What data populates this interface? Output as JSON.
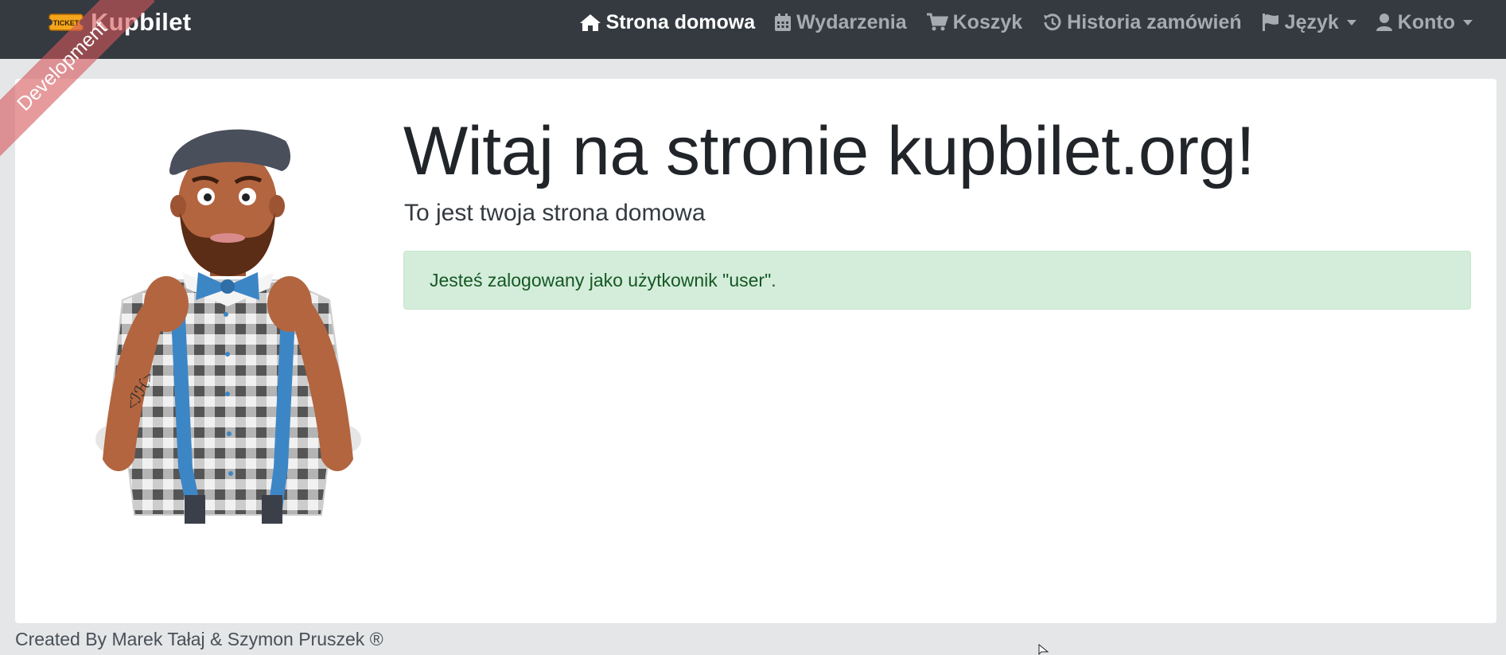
{
  "ribbon": {
    "label": "Development"
  },
  "navbar": {
    "brand_logo_text": "TICKET",
    "brand": "Kupbilet",
    "items": [
      {
        "label": "Strona domowa",
        "icon": "home-icon",
        "active": true
      },
      {
        "label": "Wydarzenia",
        "icon": "calendar-icon"
      },
      {
        "label": "Koszyk",
        "icon": "cart-icon"
      },
      {
        "label": "Historia zamówień",
        "icon": "history-icon"
      },
      {
        "label": "Język",
        "icon": "flag-icon",
        "dropdown": true
      },
      {
        "label": "Konto",
        "icon": "user-icon",
        "dropdown": true
      }
    ]
  },
  "main": {
    "title": "Witaj na stronie kupbilet.org!",
    "subtitle": "To jest twoja strona domowa",
    "alert": "Jesteś zalogowany jako użytkownik \"user\"."
  },
  "footer": {
    "text": "Created By Marek Tałaj & Szymon Pruszek ®"
  },
  "colors": {
    "navbar_bg": "#343a40",
    "nav_text": "#a6abb0",
    "nav_active": "#ffffff",
    "page_bg": "#e5e6e8",
    "alert_bg": "#d4edda",
    "alert_text": "#155724",
    "ribbon": "#d6565a"
  }
}
